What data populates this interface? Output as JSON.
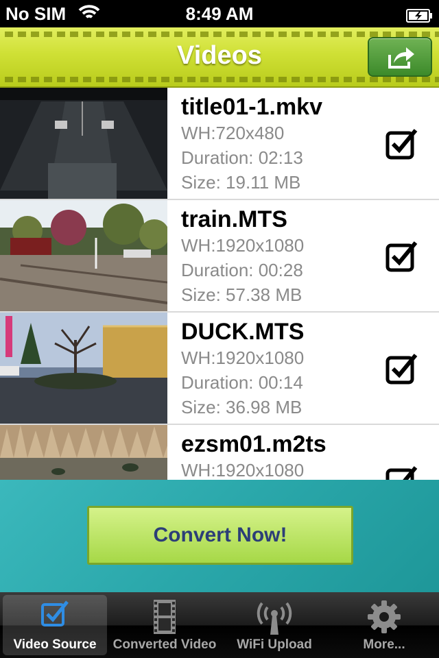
{
  "status_bar": {
    "carrier": "No SIM",
    "time": "8:49 AM"
  },
  "nav_bar": {
    "title": "Videos"
  },
  "videos": [
    {
      "name": "title01-1.mkv",
      "wh": "WH:720x480",
      "duration": "Duration: 02:13",
      "size": "Size: 19.11 MB",
      "checked": true
    },
    {
      "name": "train.MTS",
      "wh": "WH:1920x1080",
      "duration": "Duration: 00:28",
      "size": "Size: 57.38 MB",
      "checked": true
    },
    {
      "name": "DUCK.MTS",
      "wh": "WH:1920x1080",
      "duration": "Duration: 00:14",
      "size": "Size: 36.98 MB",
      "checked": true
    },
    {
      "name": "ezsm01.m2ts",
      "wh": "WH:1920x1080",
      "checked": true
    }
  ],
  "convert": {
    "label": "Convert Now!"
  },
  "tabs": [
    {
      "label": "Video Source",
      "icon": "checkbox-icon",
      "active": true
    },
    {
      "label": "Converted Video",
      "icon": "film-icon",
      "active": false
    },
    {
      "label": "WiFi Upload",
      "icon": "wifi-tower-icon",
      "active": false
    },
    {
      "label": "More...",
      "icon": "gear-icon",
      "active": false
    }
  ],
  "colors": {
    "nav_bar": "#cfe035",
    "convert_area": "#2aa7aa",
    "convert_button": "#b8e25e",
    "convert_text": "#2c3e77"
  }
}
